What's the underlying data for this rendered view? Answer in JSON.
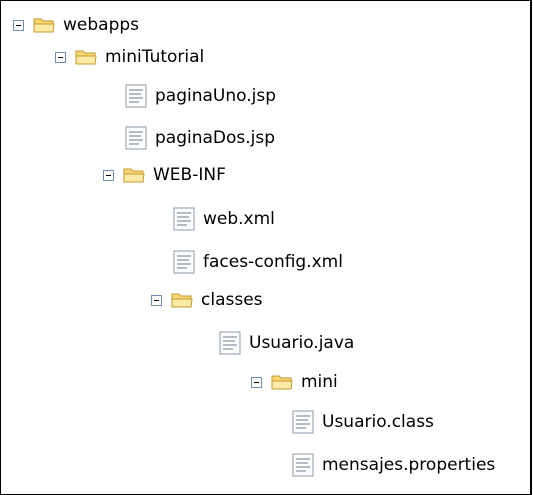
{
  "tree": {
    "nodes": [
      {
        "label": "webapps",
        "type": "folder",
        "expanded": true
      },
      {
        "label": "miniTutorial",
        "type": "folder",
        "expanded": true
      },
      {
        "label": "paginaUno.jsp",
        "type": "file"
      },
      {
        "label": "paginaDos.jsp",
        "type": "file"
      },
      {
        "label": "WEB-INF",
        "type": "folder",
        "expanded": true
      },
      {
        "label": "web.xml",
        "type": "file"
      },
      {
        "label": "faces-config.xml",
        "type": "file"
      },
      {
        "label": "classes",
        "type": "folder",
        "expanded": true
      },
      {
        "label": "Usuario.java",
        "type": "file"
      },
      {
        "label": "mini",
        "type": "folder",
        "expanded": true
      },
      {
        "label": "Usuario.class",
        "type": "file"
      },
      {
        "label": "mensajes.properties",
        "type": "file"
      }
    ]
  }
}
